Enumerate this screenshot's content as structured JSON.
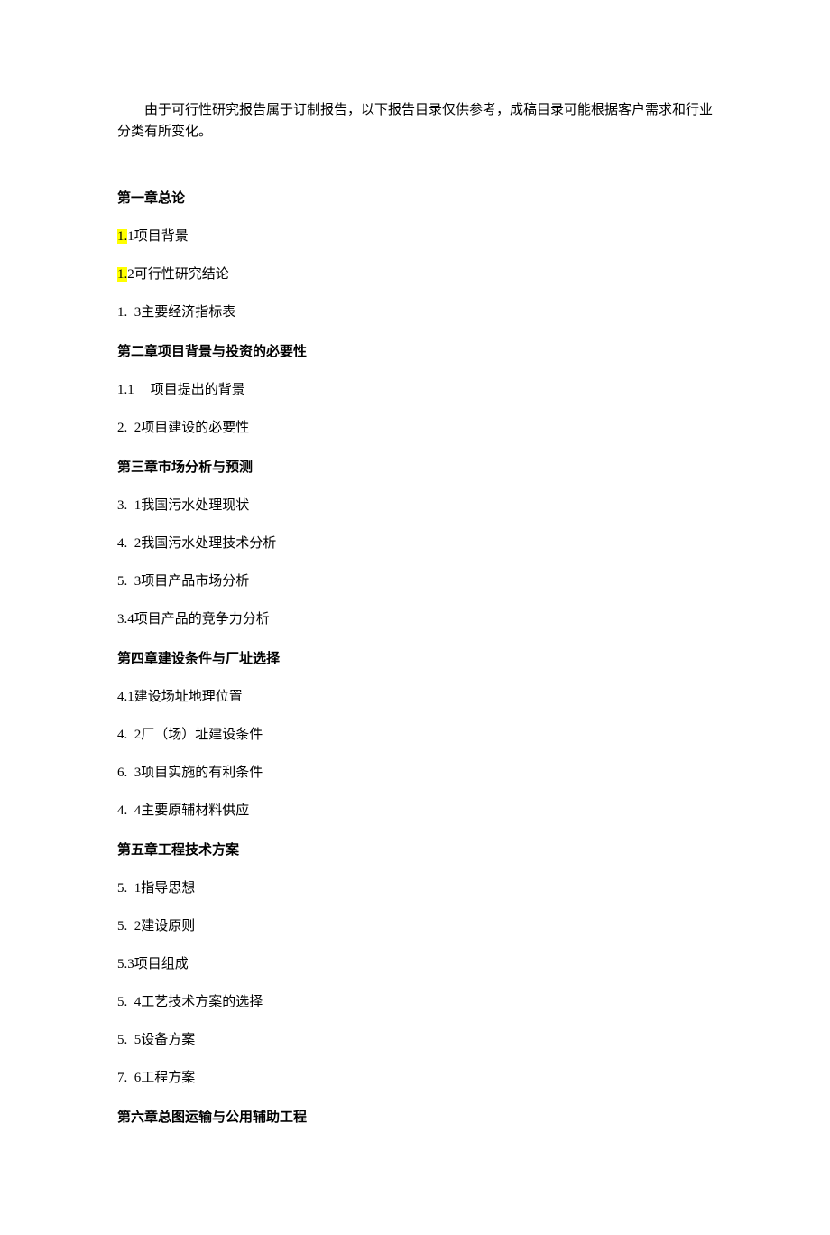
{
  "intro": "由于可行性研究报告属于订制报告，以下报告目录仅供参考，成稿目录可能根据客户需求和行业分类有所变化。",
  "sections": [
    {
      "heading": "第一章总论",
      "items": [
        {
          "prefix_hl": "1.",
          "num": "1",
          "text": "项目背景",
          "gap": "none"
        },
        {
          "prefix_hl": "1.",
          "num": "2",
          "text": "可行性研究结论",
          "gap": "none"
        },
        {
          "prefix": "1.",
          "num": "3",
          "text": "主要经济指标表",
          "gap": "normal"
        }
      ]
    },
    {
      "heading": "第二章项目背景与投资的必要性",
      "items": [
        {
          "prefix": "1.1",
          "num": "",
          "text": "项目提出的背景",
          "gap": "wide"
        },
        {
          "prefix": "2.",
          "num": "2",
          "text": "项目建设的必要性",
          "gap": "normal"
        }
      ]
    },
    {
      "heading": "第三章市场分析与预测",
      "items": [
        {
          "prefix": "3.",
          "num": "1",
          "text": "我国污水处理现状",
          "gap": "normal"
        },
        {
          "prefix": "4.",
          "num": "2",
          "text": "我国污水处理技术分析",
          "gap": "normal"
        },
        {
          "prefix": "5.",
          "num": "3",
          "text": "项目产品市场分析",
          "gap": "normal"
        },
        {
          "prefix": "3.4",
          "num": "",
          "text": "项目产品的竞争力分析",
          "gap": "none"
        }
      ]
    },
    {
      "heading": "第四章建设条件与厂址选择",
      "items": [
        {
          "prefix": "4.1",
          "num": "",
          "text": "建设场址地理位置",
          "gap": "none"
        },
        {
          "prefix": "4.",
          "num": "2",
          "text": "厂（场）址建设条件",
          "gap": "normal"
        },
        {
          "prefix": "6.",
          "num": "3",
          "text": "项目实施的有利条件",
          "gap": "normal"
        },
        {
          "prefix": "4.",
          "num": "4",
          "text": "主要原辅材料供应",
          "gap": "normal"
        }
      ]
    },
    {
      "heading": "第五章工程技术方案",
      "items": [
        {
          "prefix": "5.",
          "num": "1",
          "text": "指导思想",
          "gap": "normal"
        },
        {
          "prefix": "5.",
          "num": "2",
          "text": "建设原则",
          "gap": "normal"
        },
        {
          "prefix": "5.3",
          "num": "",
          "text": "项目组成",
          "gap": "none"
        },
        {
          "prefix": "5.",
          "num": "4",
          "text": "工艺技术方案的选择",
          "gap": "normal"
        },
        {
          "prefix": "5.",
          "num": "5",
          "text": "设备方案",
          "gap": "normal"
        },
        {
          "prefix": "7.",
          "num": "6",
          "text": "工程方案",
          "gap": "normal"
        }
      ]
    },
    {
      "heading": "第六章总图运输与公用辅助工程",
      "items": []
    }
  ]
}
